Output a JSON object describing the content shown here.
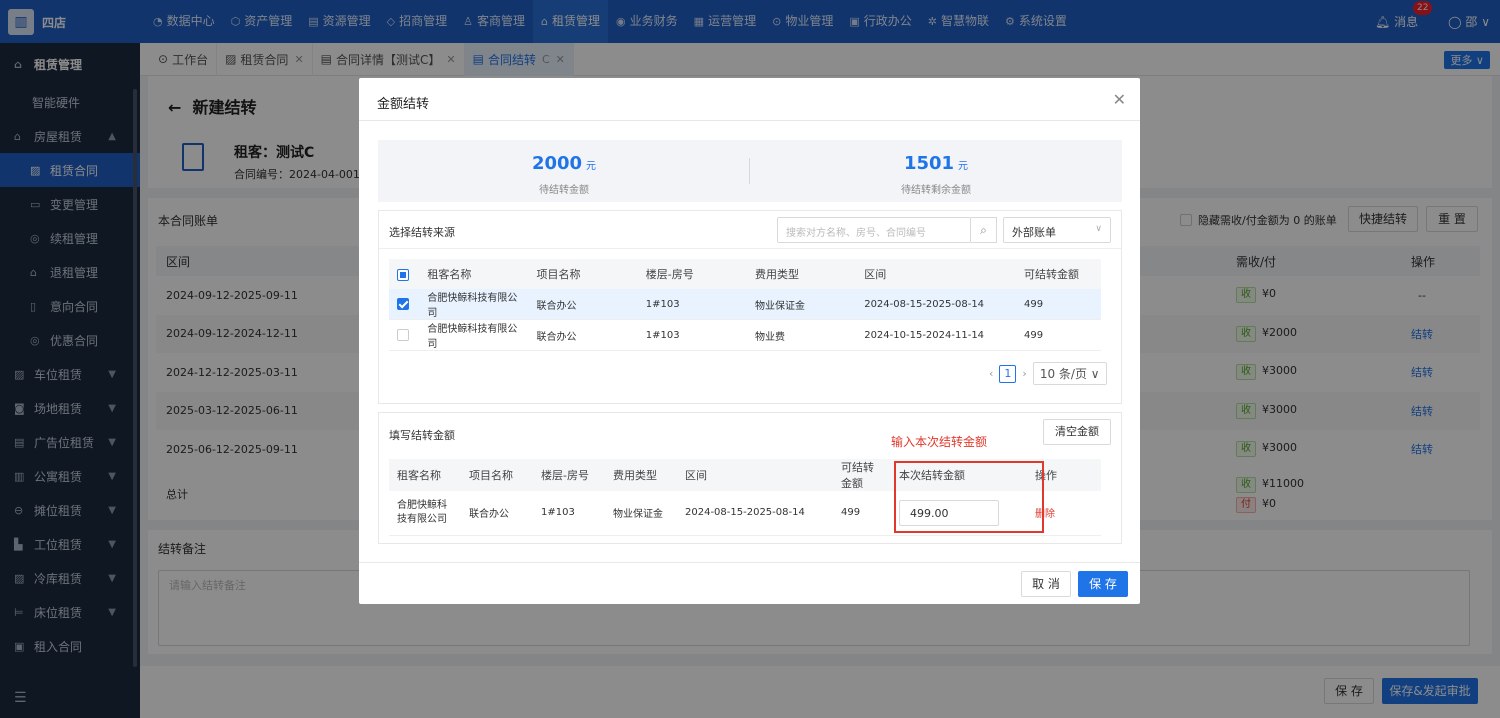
{
  "topbar": {
    "brand": "四店",
    "nav": [
      {
        "icon": "◔",
        "label": "数据中心"
      },
      {
        "icon": "⬡",
        "label": "资产管理"
      },
      {
        "icon": "▤",
        "label": "资源管理"
      },
      {
        "icon": "◇",
        "label": "招商管理"
      },
      {
        "icon": "♙",
        "label": "客商管理"
      },
      {
        "icon": "⌂",
        "label": "租赁管理",
        "active": true
      },
      {
        "icon": "◉",
        "label": "业务财务"
      },
      {
        "icon": "▦",
        "label": "运营管理"
      },
      {
        "icon": "⊙",
        "label": "物业管理"
      },
      {
        "icon": "▣",
        "label": "行政办公"
      },
      {
        "icon": "✲",
        "label": "智慧物联"
      },
      {
        "icon": "⚙",
        "label": "系统设置"
      }
    ],
    "msg_label": "消息",
    "msg_count": "22",
    "user": "邵"
  },
  "sidebar": {
    "title": "租赁管理",
    "items": [
      {
        "label": "智能硬件",
        "type": "plain"
      },
      {
        "label": "房屋租赁",
        "icon": "⌂",
        "type": "group",
        "arrow": "▲"
      },
      {
        "label": "租赁合同",
        "icon": "▨",
        "type": "sub",
        "active": true
      },
      {
        "label": "变更管理",
        "icon": "▭",
        "type": "sub"
      },
      {
        "label": "续租管理",
        "icon": "◎",
        "type": "sub"
      },
      {
        "label": "退租管理",
        "icon": "⌂",
        "type": "sub"
      },
      {
        "label": "意向合同",
        "icon": "▯",
        "type": "sub"
      },
      {
        "label": "优惠合同",
        "icon": "◎",
        "type": "sub"
      },
      {
        "label": "车位租赁",
        "icon": "▨",
        "type": "group",
        "arrow": "▼"
      },
      {
        "label": "场地租赁",
        "icon": "◙",
        "type": "group",
        "arrow": "▼"
      },
      {
        "label": "广告位租赁",
        "icon": "▤",
        "type": "group",
        "arrow": "▼"
      },
      {
        "label": "公寓租赁",
        "icon": "▥",
        "type": "group",
        "arrow": "▼"
      },
      {
        "label": "摊位租赁",
        "icon": "⊖",
        "type": "group",
        "arrow": "▼"
      },
      {
        "label": "工位租赁",
        "icon": "▙",
        "type": "group",
        "arrow": "▼"
      },
      {
        "label": "冷库租赁",
        "icon": "▨",
        "type": "group",
        "arrow": "▼"
      },
      {
        "label": "床位租赁",
        "icon": "⊨",
        "type": "group",
        "arrow": "▼"
      },
      {
        "label": "租入合同",
        "icon": "▣",
        "type": "group"
      }
    ],
    "collapse_icon": "☰"
  },
  "tabs": [
    {
      "icon": "⊙",
      "label": "工作台",
      "close": false
    },
    {
      "icon": "▨",
      "label": "租赁合同",
      "close": true
    },
    {
      "icon": "▤",
      "label": "合同详情【测试C】",
      "close": true
    },
    {
      "icon": "▤",
      "label": "合同结转",
      "close": true,
      "active": true,
      "refresh": "C"
    }
  ],
  "more_label": "更多 ∨",
  "page": {
    "back": "←",
    "title": "新建结转",
    "tenant": "租客：测试C",
    "contract_no": "合同编号：2024-04-001-2",
    "bill_section": "本合同账单",
    "hide_zero": "隐藏需收/付金额为 0 的账单",
    "quick_btn": "快捷结转",
    "reset_btn": "重 置",
    "col_range": "区间",
    "col_receivable": "需收/付",
    "col_op": "操作",
    "rows": [
      {
        "range": "2024-09-12-2025-09-11",
        "tag": "收",
        "amount": "¥0",
        "op": "--"
      },
      {
        "range": "2024-09-12-2024-12-11",
        "tag": "收",
        "amount": "¥2000",
        "op": "结转"
      },
      {
        "range": "2024-12-12-2025-03-11",
        "tag": "收",
        "amount": "¥3000",
        "op": "结转"
      },
      {
        "range": "2025-03-12-2025-06-11",
        "tag": "收",
        "amount": "¥3000",
        "op": "结转"
      },
      {
        "range": "2025-06-12-2025-09-11",
        "tag": "收",
        "amount": "¥3000",
        "op": "结转"
      }
    ],
    "total_label": "总计",
    "total_in_tag": "收",
    "total_in": "¥11000",
    "total_out_tag": "付",
    "total_out": "¥0",
    "remark_title": "结转备注",
    "remark_placeholder": "请输入结转备注",
    "save_btn": "保 存",
    "save_submit_btn": "保存&发起审批"
  },
  "modal": {
    "title": "金额结转",
    "close": "✕",
    "pending_amount": "2000",
    "pending_unit": "元",
    "pending_label": "待结转金额",
    "remain_amount": "1501",
    "remain_unit": "元",
    "remain_label": "待结转剩余金额",
    "source_title": "选择结转来源",
    "search_placeholder": "搜索对方名称、房号、合同编号",
    "search_icon": "⌕",
    "bill_type": "外部账单",
    "source_headers": [
      "租客名称",
      "项目名称",
      "楼层-房号",
      "费用类型",
      "区间",
      "可结转金额"
    ],
    "source_rows": [
      {
        "checked": true,
        "tenant": "合肥快鲸科技有限公司",
        "project": "联合办公",
        "room": "1#103",
        "fee": "物业保证金",
        "range": "2024-08-15-2025-08-14",
        "amount": "499"
      },
      {
        "checked": false,
        "tenant": "合肥快鲸科技有限公司",
        "project": "联合办公",
        "room": "1#103",
        "fee": "物业费",
        "range": "2024-10-15-2024-11-14",
        "amount": "499"
      }
    ],
    "page_num": "1",
    "page_size": "10 条/页",
    "fill_title": "填写结转金额",
    "clear_btn": "清空金额",
    "annotation": "输入本次结转金额",
    "fill_headers": [
      "租客名称",
      "项目名称",
      "楼层-房号",
      "费用类型",
      "区间",
      "可结转金额",
      "本次结转金额",
      "操作"
    ],
    "fill_row": {
      "tenant": "合肥快鲸科技有限公司",
      "project": "联合办公",
      "room": "1#103",
      "fee": "物业保证金",
      "range": "2024-08-15-2025-08-14",
      "amount": "499",
      "input": "499.00",
      "op": "删除"
    },
    "cancel_btn": "取 消",
    "save_btn": "保 存"
  }
}
